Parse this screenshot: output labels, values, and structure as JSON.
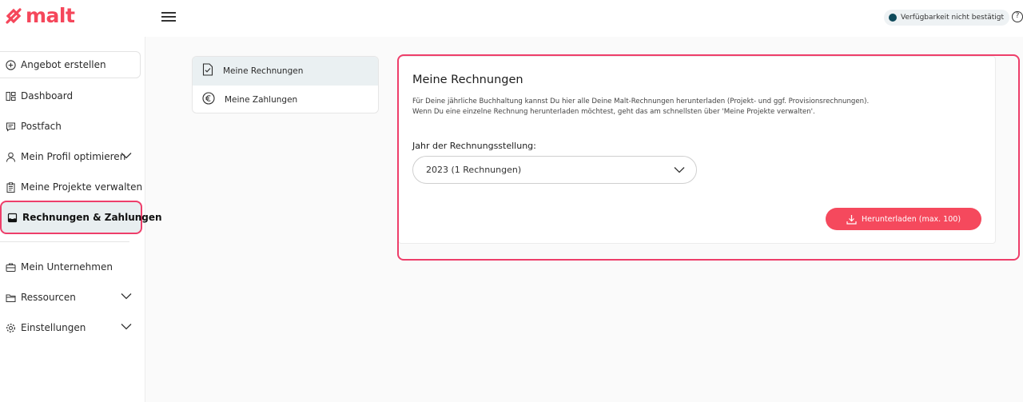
{
  "brand": {
    "logo_text": "malt",
    "logo_color": "#f5475b"
  },
  "header": {
    "availability_label": "Verfügbarkeit nicht bestätigt",
    "help_glyph": "?"
  },
  "sidebar": {
    "items": [
      {
        "label": "Angebot erstellen",
        "icon": "plus-circle-icon"
      },
      {
        "label": "Dashboard",
        "icon": "dashboard-icon"
      },
      {
        "label": "Postfach",
        "icon": "message-icon"
      },
      {
        "label": "Mein Profil optimieren",
        "icon": "user-icon",
        "expandable": true
      },
      {
        "label": "Meine Projekte verwalten",
        "icon": "clipboard-icon"
      },
      {
        "label": "Rechnungen & Zahlungen",
        "icon": "inbox-icon",
        "active": true
      },
      {
        "label": "Mein Unternehmen",
        "icon": "briefcase-icon"
      },
      {
        "label": "Ressourcen",
        "icon": "folder-icon",
        "expandable": true
      },
      {
        "label": "Einstellungen",
        "icon": "gear-icon",
        "expandable": true
      }
    ]
  },
  "subnav": {
    "items": [
      {
        "label": "Meine Rechnungen",
        "icon": "invoice-icon",
        "active": true
      },
      {
        "label": "Meine Zahlungen",
        "icon": "euro-icon"
      }
    ]
  },
  "main": {
    "title": "Meine Rechnungen",
    "description_line1": "Für Deine jährliche Buchhaltung kannst Du hier alle Deine Malt-Rechnungen herunterladen (Projekt- und ggf. Provisionsrechnungen).",
    "description_line2": "Wenn Du eine einzelne Rechnung herunterladen möchtest, geht das am schnellsten über 'Meine Projekte verwalten'.",
    "year_label": "Jahr der Rechnungsstellung:",
    "year_selected": "2023 (1 Rechnungen)",
    "download_label": "Herunterladen (max. 100)"
  },
  "colors": {
    "accent": "#f5495d",
    "highlight": "#ee3e6a",
    "active_bg": "#e8eef0",
    "status_dot": "#0f4a5b"
  }
}
